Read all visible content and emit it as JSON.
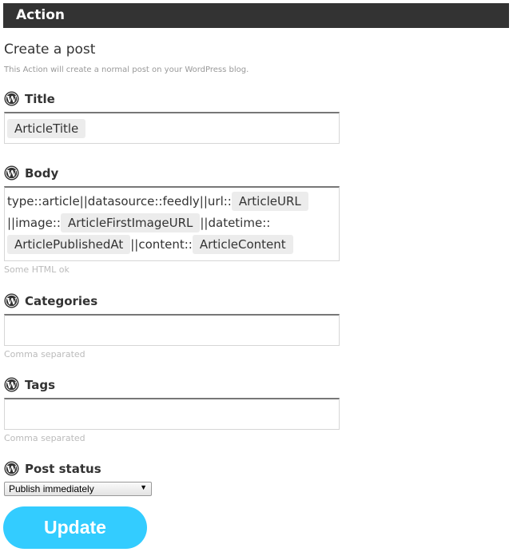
{
  "header": {
    "title": "Action"
  },
  "action": {
    "title": "Create a post",
    "description": "This Action will create a normal post on your WordPress blog."
  },
  "fields": {
    "title": {
      "label": "Title",
      "icon": "wordpress-icon",
      "ingredients": [
        "ArticleTitle"
      ]
    },
    "body": {
      "label": "Body",
      "icon": "wordpress-icon",
      "segments": [
        {
          "type": "text",
          "value": "type::article||datasource::feedly||url::"
        },
        {
          "type": "ingredient",
          "value": "ArticleURL"
        },
        {
          "type": "text",
          "value": "||image::"
        },
        {
          "type": "ingredient",
          "value": "ArticleFirstImageURL"
        },
        {
          "type": "text",
          "value": "||datetime::"
        },
        {
          "type": "ingredient",
          "value": "ArticlePublishedAt"
        },
        {
          "type": "text",
          "value": "||content::"
        },
        {
          "type": "ingredient",
          "value": "ArticleContent"
        }
      ],
      "hint": "Some HTML ok"
    },
    "categories": {
      "label": "Categories",
      "icon": "wordpress-icon",
      "value": "",
      "hint": "Comma separated"
    },
    "tags": {
      "label": "Tags",
      "icon": "wordpress-icon",
      "value": "",
      "hint": "Comma separated"
    },
    "post_status": {
      "label": "Post status",
      "icon": "wordpress-icon",
      "selected": "Publish immediately"
    }
  },
  "buttons": {
    "update": "Update"
  },
  "colors": {
    "header_bg": "#333333",
    "button_bg": "#33ccff",
    "pill_bg": "#ececec"
  }
}
